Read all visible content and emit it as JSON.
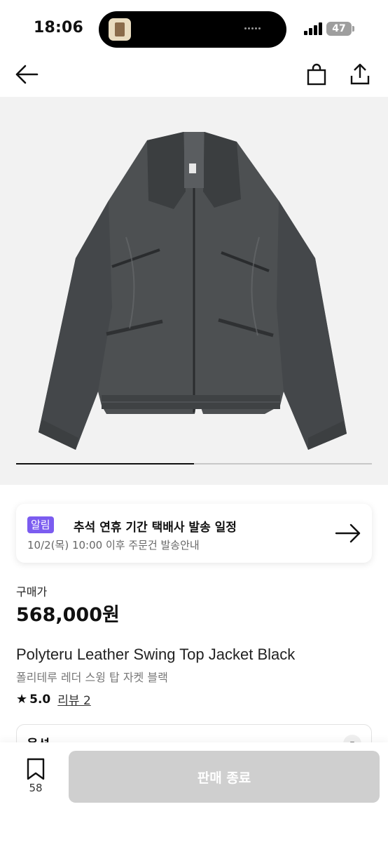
{
  "status_bar": {
    "time": "18:06",
    "battery": "47"
  },
  "icons": {
    "back": "arrow-left-icon",
    "cart": "shopping-bag-icon",
    "share": "share-icon",
    "notice_arrow": "arrow-right-icon",
    "bookmark": "bookmark-icon",
    "star": "star-icon"
  },
  "image": {
    "progress": 0.5
  },
  "notice": {
    "badge": "알림",
    "title": "추석 연휴 기간 택배사 발송 일정",
    "subtitle": "10/2(목) 10:00 이후 주문건 발송안내"
  },
  "product": {
    "price_label": "구매가",
    "price": "568,000원",
    "name_en": "Polyteru Leather Swing Top Jacket Black",
    "name_ko": "폴리테루 레더 스윙 탑 자켓 블랙",
    "rating": "5.0",
    "review_link": "리뷰 2",
    "option_label": "옵션",
    "option_toggle": "-"
  },
  "bottom_bar": {
    "bookmark_count": "58",
    "cta": "판매 종료"
  },
  "colors": {
    "badge": "#7b5cf0",
    "cta_disabled": "#cfcfcf",
    "hero_bg": "#f2f2f2"
  }
}
